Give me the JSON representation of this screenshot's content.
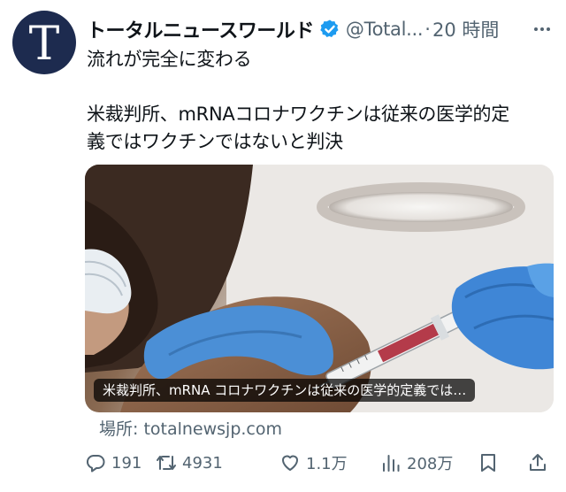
{
  "author": {
    "avatar_letter": "T",
    "name": "トータルニュースワールド",
    "handle": "@Total...",
    "separator": "·",
    "time": "20 時間"
  },
  "post": {
    "line1": "流れが完全に変わる",
    "headline_1": "米裁判所、mRNAコロナワクチンは従来の医学的定",
    "headline_2": "義ではワクチンではないと判決"
  },
  "card": {
    "caption": "米裁判所、mRNA コロナワクチンは従来の医学的定義では…",
    "source": "場所: totalnewsjp.com"
  },
  "actions": {
    "replies": "191",
    "reposts": "4931",
    "likes": "1.1万",
    "views": "208万"
  },
  "colors": {
    "verified": "#1d9bf0",
    "muted_text": "#536471",
    "avatar_bg": "#1d2b4f"
  }
}
